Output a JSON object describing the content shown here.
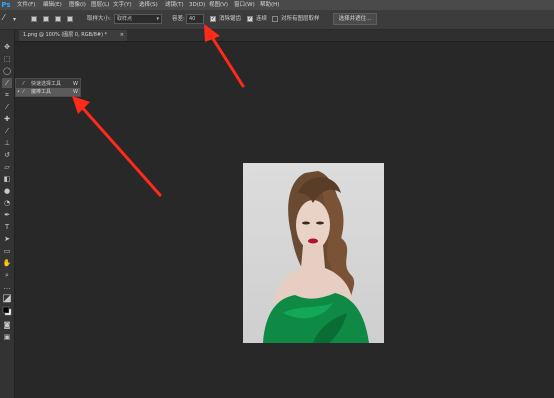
{
  "app": {
    "logo": "Ps",
    "brand_color": "#31a8ff"
  },
  "menubar": {
    "items": [
      "文件(F)",
      "编辑(E)",
      "图像(I)",
      "图层(L)",
      "文字(Y)",
      "选择(S)",
      "滤镜(T)",
      "3D(D)",
      "视图(V)",
      "窗口(W)",
      "帮助(H)"
    ]
  },
  "options": {
    "sample_size_label": "取样大小:",
    "sample_size_value": "取样点",
    "tolerance_label": "容差:",
    "tolerance_value": "40",
    "antialias_label": "消除锯齿",
    "antialias_checked": true,
    "contiguous_label": "连续",
    "contiguous_checked": true,
    "sample_all_layers_label": "对所有图层取样",
    "sample_all_layers_checked": false,
    "select_subject_button": "选择并遮住..."
  },
  "document": {
    "tab_title": "1.png @ 100% (图层 0, RGB/8#) *",
    "close_glyph": "×"
  },
  "flyout": {
    "items": [
      {
        "label": "快速选择工具",
        "shortcut": "W",
        "icon": "quick-selection-icon",
        "selected": false
      },
      {
        "label": "魔棒工具",
        "shortcut": "W",
        "icon": "magic-wand-icon",
        "selected": true
      }
    ]
  },
  "colors": {
    "menubar_bg": "#4a4a4a",
    "options_bg": "#3c3c3c",
    "canvas_bg": "#282828",
    "annotation_arrow": "#ff2a1a",
    "dress_green": "#0f8a45"
  }
}
